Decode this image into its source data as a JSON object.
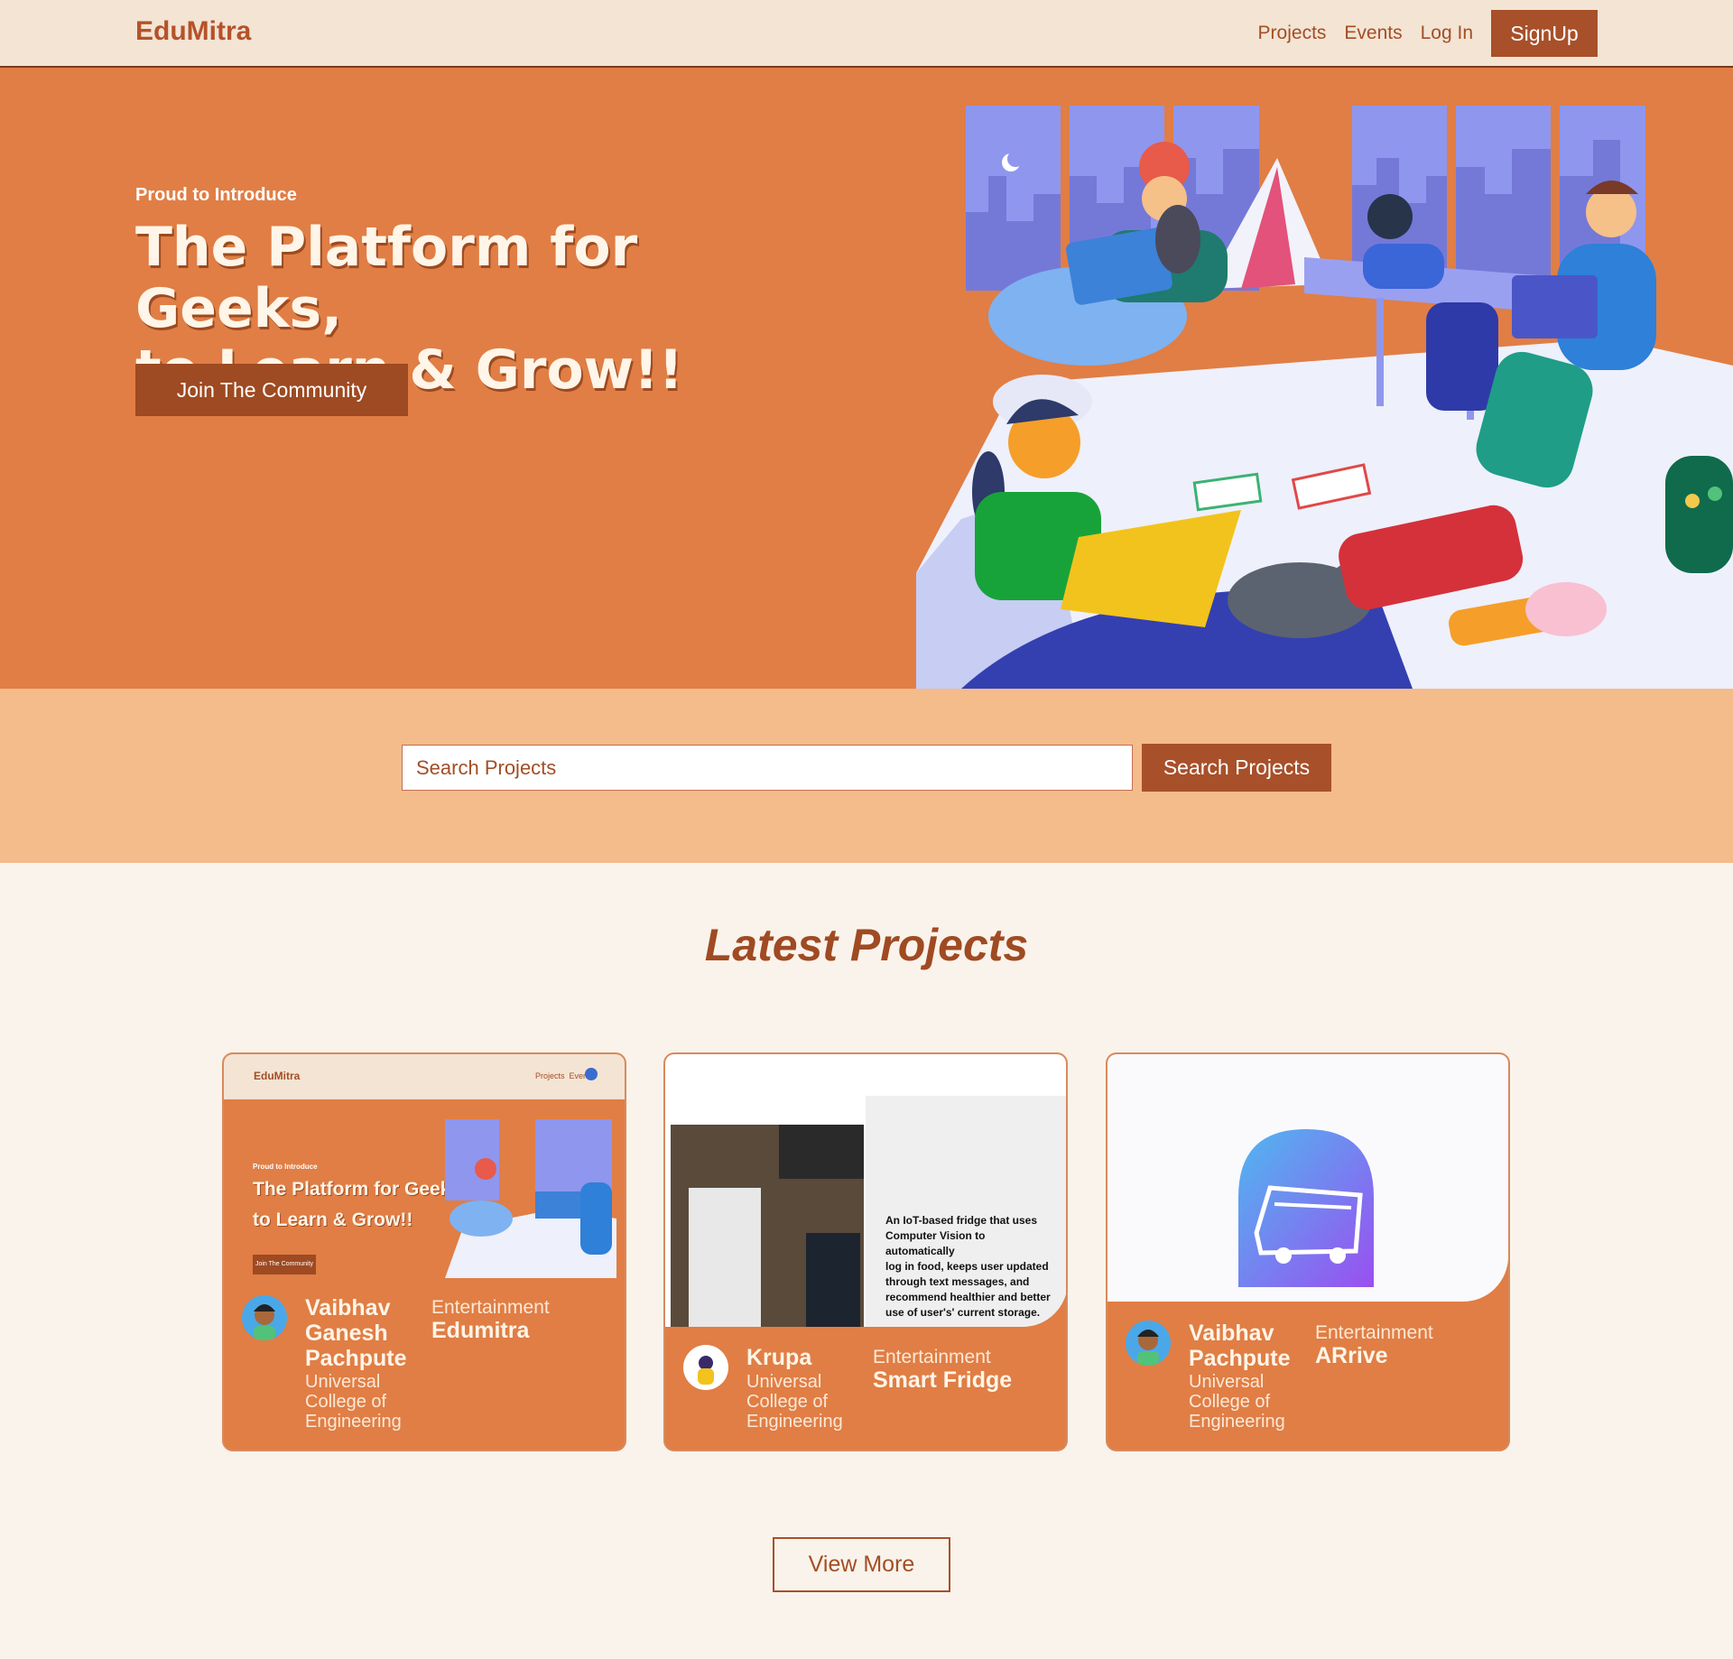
{
  "nav": {
    "brand": "EduMitra",
    "links": [
      "Projects",
      "Events",
      "Log In"
    ],
    "signup": "SignUp"
  },
  "hero": {
    "kicker": "Proud to Introduce",
    "title": "The Platform for Geeks,\nto Learn & Grow!!",
    "cta": "Join The Community"
  },
  "search": {
    "placeholder": "Search Projects",
    "button": "Search Projects"
  },
  "latest": {
    "title": "Latest Projects",
    "cards": [
      {
        "author": "Vaibhav Ganesh Pachpute",
        "college": "Universal College of Engineering",
        "category": "Entertainment",
        "project": "Edumitra",
        "thumb": {
          "brand": "EduMitra",
          "links": "Projects  Events",
          "kicker": "Proud to Introduce",
          "title1": "The Platform for Geeks,",
          "title2": "to Learn & Grow!!",
          "cta": "Join The Community"
        }
      },
      {
        "author": "Krupa",
        "college": "Universal College of Engineering",
        "category": "Entertainment",
        "project": "Smart Fridge",
        "thumb": {
          "caption": [
            "An IoT-based fridge that uses",
            "Computer Vision to automatically",
            "log in food, keeps user updated",
            "through text messages, and",
            "recommend healthier and better",
            "use of user's' current storage."
          ]
        }
      },
      {
        "author": "Vaibhav Pachpute",
        "college": "Universal College of Engineering",
        "category": "Entertainment",
        "project": "ARrive",
        "thumb": {}
      }
    ],
    "view_more": "View More"
  },
  "colors": {
    "accent": "#e07e45",
    "brand": "#a8502a",
    "nav_bg": "#f3e4d4",
    "search_band": "#f4bb8b",
    "page_bg": "#f9f3eb"
  }
}
